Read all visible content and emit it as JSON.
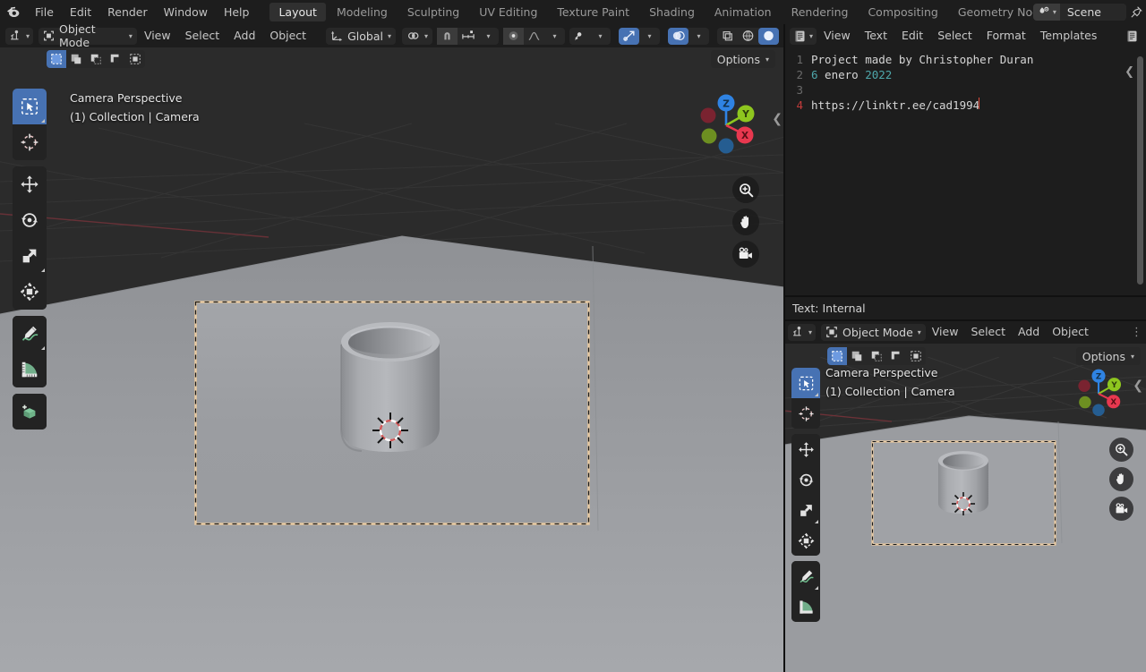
{
  "topbar": {
    "logo_icon": "blender-logo-icon",
    "menus": [
      "File",
      "Edit",
      "Render",
      "Window",
      "Help"
    ],
    "workspace_tabs": [
      {
        "label": "Layout",
        "active": true
      },
      {
        "label": "Modeling",
        "active": false
      },
      {
        "label": "Sculpting",
        "active": false
      },
      {
        "label": "UV Editing",
        "active": false
      },
      {
        "label": "Texture Paint",
        "active": false
      },
      {
        "label": "Shading",
        "active": false
      },
      {
        "label": "Animation",
        "active": false
      },
      {
        "label": "Rendering",
        "active": false
      },
      {
        "label": "Compositing",
        "active": false
      },
      {
        "label": "Geometry Noc",
        "active": false
      }
    ],
    "scene_icon": "scene-icon",
    "scene_name": "Scene",
    "pin_icon": "pin-icon",
    "chevron": "▾"
  },
  "viewport_main": {
    "header": {
      "editor_type_icon": "editor-type-3dview-icon",
      "mode_icon": "object-mode-icon",
      "mode_label": "Object Mode",
      "menus": [
        "View",
        "Select",
        "Add",
        "Object"
      ],
      "transform_orientation_icon": "orientation-axes-icon",
      "transform_orientation": "Global",
      "pivot_icon": "pivot-point-icon",
      "snap_icon": "snap-magnet-icon",
      "snap_target_icon": "snap-increment-icon",
      "proportional_icon": "proportional-editing-icon",
      "proportional_falloff_icon": "falloff-smooth-icon",
      "gizmo_icon": "gizmo-icon",
      "overlays_icon": "overlays-icon",
      "xray_icon": "xray-toggle-icon",
      "shading_solid_icon": "shading-solid-icon",
      "shading_material_icon": "shading-material-icon",
      "shading_rendered_icon": "shading-rendered-icon"
    },
    "select_modes": [
      {
        "icon": "select-box-icon",
        "active": true
      },
      {
        "icon": "select-extend-icon",
        "active": false
      },
      {
        "icon": "select-subtract-icon",
        "active": false
      },
      {
        "icon": "select-intersect-icon",
        "active": false
      },
      {
        "icon": "select-invert-icon",
        "active": false
      }
    ],
    "options_label": "Options",
    "overlay_line1": "Camera Perspective",
    "overlay_line2": "(1) Collection | Camera",
    "toolbar": [
      {
        "icon": "tweak-select-box-icon",
        "active": true,
        "corner": true
      },
      {
        "icon": "cursor-3d-icon",
        "active": false,
        "corner": false
      },
      {
        "icon": "move-icon",
        "active": false,
        "corner": false
      },
      {
        "icon": "rotate-icon",
        "active": false,
        "corner": false
      },
      {
        "icon": "scale-icon",
        "active": false,
        "corner": true
      },
      {
        "icon": "transform-icon",
        "active": false,
        "corner": false
      },
      {
        "icon": "annotate-icon",
        "active": false,
        "corner": true
      },
      {
        "icon": "measure-icon",
        "active": false,
        "corner": false
      },
      {
        "icon": "add-cube-icon",
        "active": false,
        "corner": false
      }
    ],
    "gizmo_axes": [
      {
        "label": "Z",
        "color": "#2f83e3"
      },
      {
        "label": "Y",
        "color": "#8ec61f"
      },
      {
        "label": "X",
        "color": "#e8384f"
      }
    ],
    "gizmo_neg_axes": [
      {
        "label": "-Z",
        "color": "#1f4d7f"
      },
      {
        "label": "-Y",
        "color": "#5b7a18"
      },
      {
        "label": "-X",
        "color": "#7a2330"
      }
    ],
    "nav_buttons": [
      {
        "icon": "zoom-icon"
      },
      {
        "icon": "pan-hand-icon"
      },
      {
        "icon": "camera-view-icon"
      }
    ],
    "collapse_icon": "chevron-left-icon"
  },
  "text_editor": {
    "header": {
      "editor_type_icon": "editor-type-text-icon",
      "menus": [
        "View",
        "Text",
        "Edit",
        "Select",
        "Format",
        "Templates"
      ],
      "datablock_icon": "text-datablock-icon"
    },
    "lines": [
      {
        "num": "1",
        "text": "Project made by Christopher Duran",
        "current": false
      },
      {
        "num": "2",
        "text": "6 enero 2022",
        "current": false,
        "numeric_tokens": [
          "6",
          "2022"
        ]
      },
      {
        "num": "3",
        "text": "",
        "current": false
      },
      {
        "num": "4",
        "text": "https://linktr.ee/cad1994",
        "current": true,
        "caret": true
      }
    ],
    "collapse_icon": "chevron-left-icon",
    "status_label": "Text: Internal"
  },
  "viewport_small": {
    "header": {
      "editor_type_icon": "editor-type-3dview-icon",
      "mode_icon": "object-mode-icon",
      "mode_label": "Object Mode",
      "menus": [
        "View",
        "Select",
        "Add",
        "Object"
      ]
    },
    "select_modes": [
      {
        "icon": "select-box-icon",
        "active": true
      },
      {
        "icon": "select-extend-icon",
        "active": false
      },
      {
        "icon": "select-subtract-icon",
        "active": false
      },
      {
        "icon": "select-intersect-icon",
        "active": false
      },
      {
        "icon": "select-invert-icon",
        "active": false
      }
    ],
    "options_label": "Options",
    "overlay_line1": "Camera Perspective",
    "overlay_line2": "(1) Collection | Camera",
    "toolbar": [
      {
        "icon": "tweak-select-box-icon",
        "active": true,
        "corner": true
      },
      {
        "icon": "cursor-3d-icon",
        "active": false,
        "corner": false
      },
      {
        "icon": "move-icon",
        "active": false,
        "corner": false
      },
      {
        "icon": "rotate-icon",
        "active": false,
        "corner": false
      },
      {
        "icon": "scale-icon",
        "active": false,
        "corner": true
      },
      {
        "icon": "transform-icon",
        "active": false,
        "corner": false
      },
      {
        "icon": "annotate-icon",
        "active": false,
        "corner": true
      },
      {
        "icon": "measure-icon",
        "active": false,
        "corner": false
      }
    ],
    "gizmo_axes": [
      {
        "label": "Z",
        "color": "#2f83e3"
      },
      {
        "label": "Y",
        "color": "#8ec61f"
      },
      {
        "label": "X",
        "color": "#e8384f"
      }
    ],
    "nav_buttons": [
      {
        "icon": "zoom-icon"
      },
      {
        "icon": "pan-hand-icon"
      },
      {
        "icon": "camera-view-icon"
      }
    ],
    "collapse_icon": "chevron-left-icon"
  },
  "scene": {
    "object": "cylinder-cup-mesh",
    "camera_frame_border": "#e8c9a0",
    "background": "#2b2b2b",
    "floor_plane": "#9a9ca0"
  },
  "colors": {
    "accent_blue": "#4772b3",
    "panel_dark": "#1d1d1d",
    "panel_mid": "#282828",
    "viewport_bg": "#2b2b2b",
    "text": "#d2d2d2",
    "axis_x": "#e8384f",
    "axis_y": "#8ec61f",
    "axis_z": "#2f83e3"
  }
}
